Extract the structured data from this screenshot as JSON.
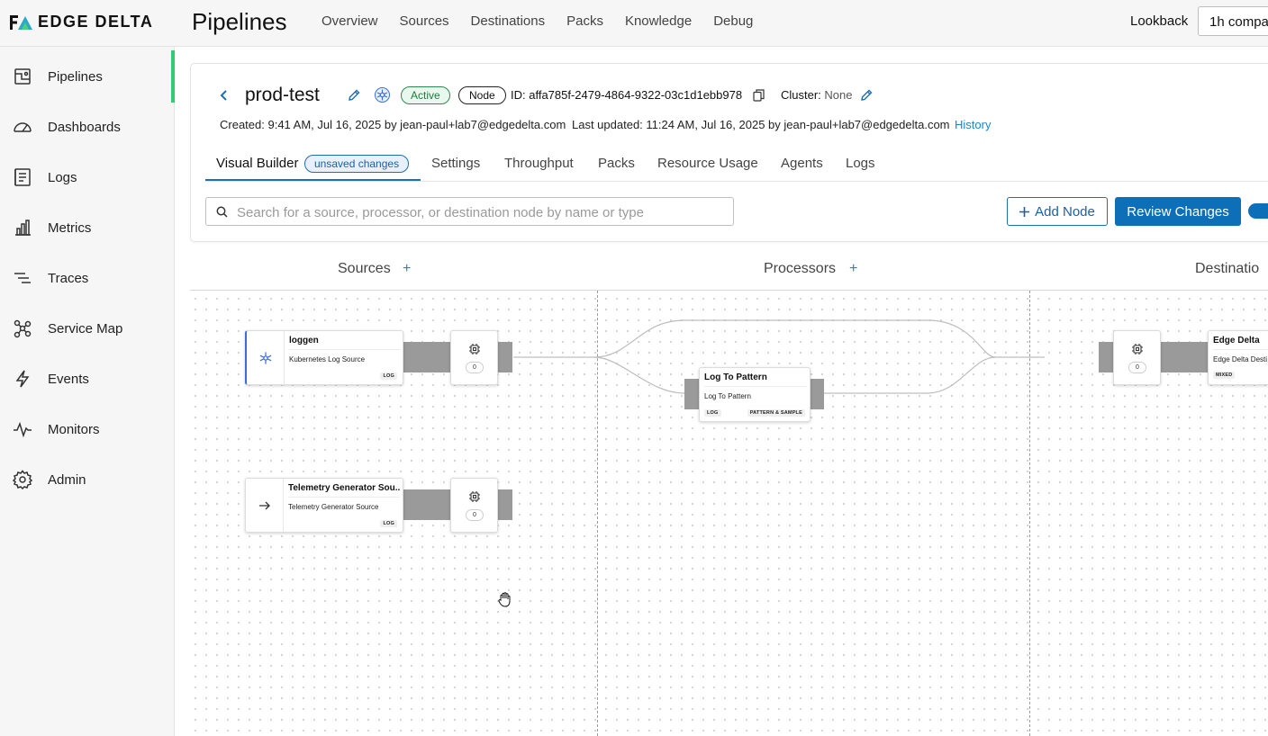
{
  "brand": {
    "name": "EDGE DELTA",
    "colors": {
      "accent": "#0d6fb8",
      "active_green": "#2fcc72",
      "link": "#1e86c9"
    }
  },
  "header": {
    "title": "Pipelines",
    "nav": [
      "Overview",
      "Sources",
      "Destinations",
      "Packs",
      "Knowledge",
      "Debug"
    ],
    "lookback_label": "Lookback",
    "lookback_value": "1h compa"
  },
  "sidebar": {
    "items": [
      {
        "label": "Pipelines",
        "icon": "pipelines-icon",
        "active": true
      },
      {
        "label": "Dashboards",
        "icon": "dashboard-gauge-icon"
      },
      {
        "label": "Logs",
        "icon": "logs-document-icon"
      },
      {
        "label": "Metrics",
        "icon": "bar-chart-icon"
      },
      {
        "label": "Traces",
        "icon": "traces-icon"
      },
      {
        "label": "Service Map",
        "icon": "service-map-icon"
      },
      {
        "label": "Events",
        "icon": "lightning-icon"
      },
      {
        "label": "Monitors",
        "icon": "pulse-icon"
      },
      {
        "label": "Admin",
        "icon": "gear-icon"
      }
    ]
  },
  "pipeline": {
    "name": "prod-test",
    "status": "Active",
    "type": "Node",
    "id_text": "ID: affa785f-2479-4864-9322-03c1d1ebb978",
    "cluster_label": "Cluster:",
    "cluster_value": "None",
    "created": "Created: 9:41 AM, Jul 16, 2025 by jean-paul+lab7@edgedelta.com",
    "updated": "Last updated: 11:24 AM, Jul 16, 2025 by jean-paul+lab7@edgedelta.com",
    "history_link": "History"
  },
  "tabs": {
    "items": [
      "Visual Builder",
      "Settings",
      "Throughput",
      "Packs",
      "Resource Usage",
      "Agents",
      "Logs"
    ],
    "active": "Visual Builder",
    "unsaved_badge": "unsaved changes"
  },
  "toolbar": {
    "search_placeholder": "Search for a source, processor, or destination node by name or type",
    "add_node_label": "Add Node",
    "review_label": "Review Changes"
  },
  "canvas": {
    "columns": [
      {
        "title": "Sources",
        "plus": "+"
      },
      {
        "title": "Processors",
        "plus": "+"
      },
      {
        "title": "Destinatio"
      }
    ],
    "sources": [
      {
        "title": "loggen",
        "subtitle": "Kubernetes Log Source",
        "tag": "LOG",
        "icon": "kubernetes-icon",
        "count": "0"
      },
      {
        "title": "Telemetry Generator Sou...",
        "subtitle": "Telemetry Generator Source",
        "tag": "LOG",
        "icon": "arrow-right-icon",
        "count": "0"
      }
    ],
    "processors": [
      {
        "title": "Log To Pattern",
        "subtitle": "Log To Pattern",
        "tags": [
          "LOG",
          "PATTERN & SAMPLE"
        ]
      }
    ],
    "destinations": [
      {
        "title": "Edge Delta",
        "subtitle": "Edge Delta Desti",
        "tag": "MIXED",
        "count": "0"
      }
    ]
  }
}
